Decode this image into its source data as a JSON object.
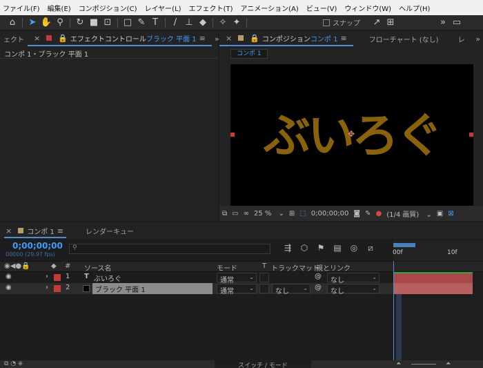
{
  "menu": [
    "ファイル(F)",
    "編集(E)",
    "コンポジション(C)",
    "レイヤー(L)",
    "エフェクト(T)",
    "アニメーション(A)",
    "ビュー(V)",
    "ウィンドウ(W)",
    "ヘルプ(H)"
  ],
  "toolbar": {
    "snap_label": "スナップ"
  },
  "effects_panel": {
    "left_tab_partial": "ェクト",
    "tab_prefix": "エフェクトコントロール",
    "tab_layer": "ブラック 平面 1",
    "breadcrumb": "コンポ 1・ブラック 平面 1"
  },
  "comp_panel": {
    "tab_prefix": "コンポジション",
    "tab_comp": "コンポ 1",
    "flowchart_tab": "フローチャート (なし)",
    "right_tab_partial": "レ",
    "subtab": "コンポ 1",
    "text_layer_content": "ぶいろぐ",
    "zoom": "25 %",
    "timecode": "0;00;00;00",
    "resolution": "(1/4 画質)"
  },
  "timeline": {
    "tab": "コンポ 1",
    "render_queue_tab": "レンダーキュー",
    "timecode": "0;00;00;00",
    "fps": "00000 (29.97 fps)",
    "ruler_start": "00f",
    "ruler_mark": "10f",
    "columns": {
      "hash": "#",
      "source": "ソース名",
      "mode": "モード",
      "t": "T",
      "trackmatte": "トラックマット",
      "parent": "親とリンク"
    },
    "layers": [
      {
        "num": "1",
        "type_icon": "T",
        "name": "ぶいろぐ",
        "mode": "通常",
        "trackmatte": "",
        "parent": "なし",
        "label_color": "#c63a3a"
      },
      {
        "num": "2",
        "type_icon": "",
        "name": "ブラック 平面 1",
        "mode": "通常",
        "trackmatte": "なし",
        "parent": "なし",
        "label_color": "#c63a3a"
      }
    ],
    "switch_mode": "スイッチ / モード"
  },
  "colors": {
    "accent": "#3d9cff",
    "text_fill": "#8a6208",
    "label_red": "#c63a3a",
    "handle_red": "#c8393a"
  }
}
